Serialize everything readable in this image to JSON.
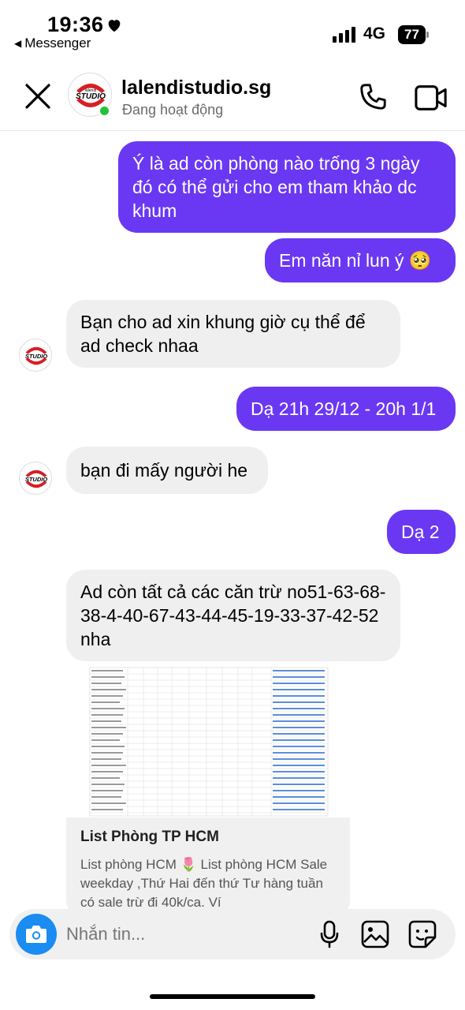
{
  "status_bar": {
    "time": "19:36",
    "back_app": "Messenger",
    "network": "4G",
    "battery": "77"
  },
  "header": {
    "contact_name": "lalendistudio.sg",
    "contact_status": "Đang hoạt động",
    "avatar_text_top": "lalendi",
    "avatar_text_main": "STUDIO"
  },
  "messages": [
    {
      "direction": "out",
      "text": "Ý là ad còn phòng nào trống 3 ngày đó có thể gửi cho em tham khảo dc khum"
    },
    {
      "direction": "out",
      "text": "Em năn nỉ lun ý 🥺"
    },
    {
      "direction": "in",
      "text": "Bạn cho ad xin khung giờ cụ thể để ad check nhaa"
    },
    {
      "direction": "out",
      "text": "Dạ 21h 29/12 - 20h 1/1"
    },
    {
      "direction": "in",
      "text": "bạn đi mấy người he"
    },
    {
      "direction": "out",
      "text": "Dạ 2"
    },
    {
      "direction": "in",
      "text": "Ad còn tất cả các căn trừ no51-63-68-38-4-40-67-43-44-45-19-33-37-42-52 nha"
    }
  ],
  "link_card": {
    "title": "List Phòng TP HCM",
    "description": "List phòng HCM 🌷 List phòng HCM Sale weekday ,Thứ Hai đến thứ Tư hàng tuần có sale trừ đi 40k/ca. Ví"
  },
  "composer": {
    "placeholder": "Nhắn tin..."
  },
  "colors": {
    "outgoing_bubble": "#6a38f3",
    "incoming_bubble": "#efefef",
    "online_dot": "#1fc436",
    "camera_button": "#1a8cf2"
  }
}
